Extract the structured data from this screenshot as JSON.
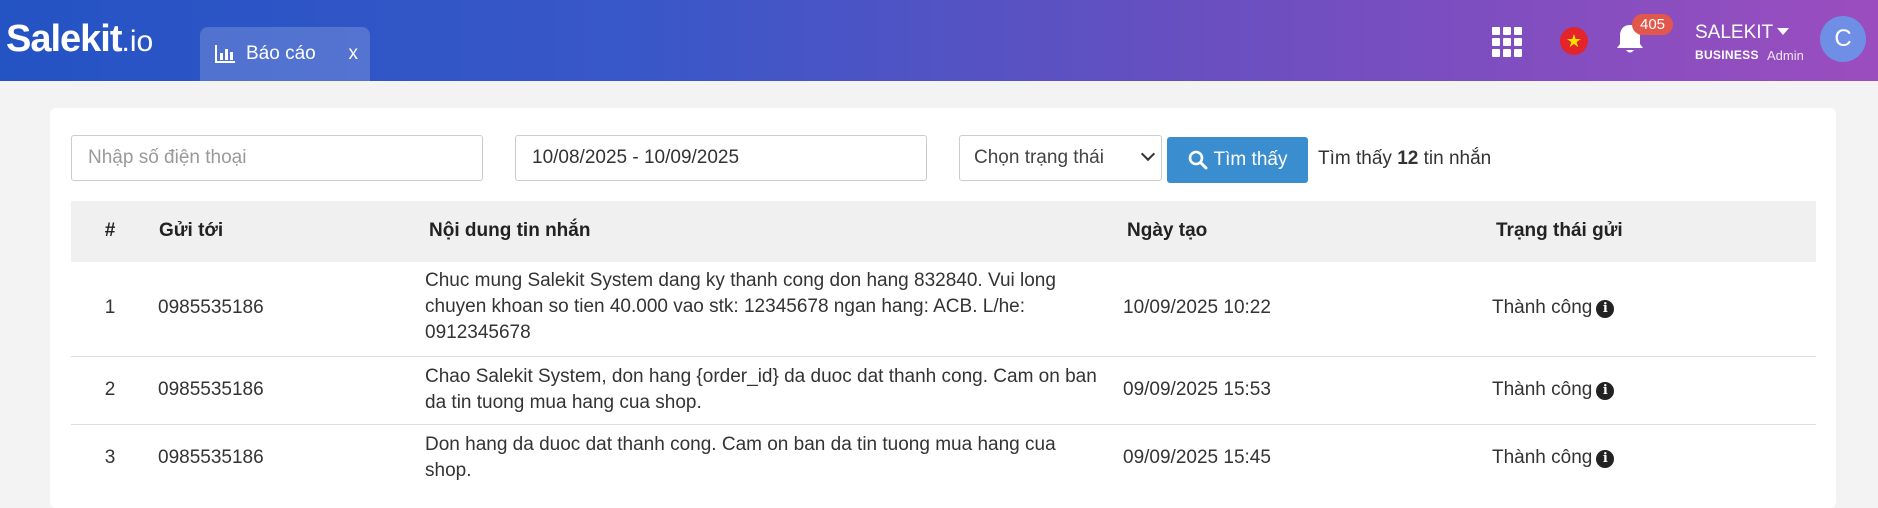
{
  "header": {
    "logo_main": "Salekit",
    "logo_suffix": ".io",
    "tab_label": "Báo cáo",
    "tab_close": "x",
    "notification_count": "405",
    "user_name": "SALEKIT",
    "user_plan": "BUSINESS",
    "user_role": "Admin",
    "avatar_initial": "C",
    "flag_star": "★",
    "colors": {
      "gradient_start": "#2453c4",
      "gradient_end": "#9b4dbf",
      "badge": "#e2574c"
    }
  },
  "filters": {
    "phone_placeholder": "Nhập số điện thoại",
    "date_range": "10/08/2025 - 10/09/2025",
    "status_placeholder": "Chọn trạng thái",
    "search_label": "Tìm thấy",
    "result_prefix": "Tìm thấy",
    "result_count": "12",
    "result_suffix": "tin nhắn"
  },
  "table": {
    "headers": {
      "num": "#",
      "to": "Gửi tới",
      "content": "Nội dung tin nhắn",
      "created": "Ngày tạo",
      "status": "Trạng thái gửi"
    },
    "rows": [
      {
        "num": "1",
        "to": "0985535186",
        "content": "Chuc mung Salekit System dang ky thanh cong don hang 832840. Vui long chuyen khoan so tien 40.000 vao stk: 12345678 ngan hang: ACB. L/he: 0912345678",
        "created": "10/09/2025 10:22",
        "status": "Thành công"
      },
      {
        "num": "2",
        "to": "0985535186",
        "content": "Chao Salekit System, don hang {order_id} da duoc dat thanh cong. Cam on ban da tin tuong mua hang cua shop.",
        "created": "09/09/2025 15:53",
        "status": "Thành công"
      },
      {
        "num": "3",
        "to": "0985535186",
        "content": "Don hang da duoc dat thanh cong. Cam on ban da tin tuong mua hang cua shop.",
        "created": "09/09/2025 15:45",
        "status": "Thành công"
      }
    ],
    "info_glyph": "i"
  }
}
